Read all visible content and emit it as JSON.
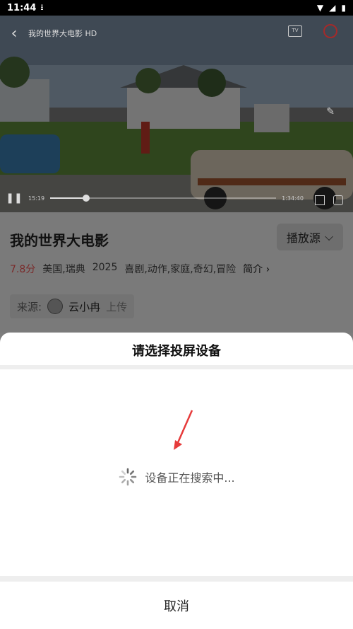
{
  "status_bar": {
    "time": "11:44"
  },
  "player": {
    "title": "我的世界大电影 HD",
    "elapsed": "15:19",
    "total": "1:34:40",
    "progress": 0.16
  },
  "movie": {
    "title": "我的世界大电影",
    "source_button": "播放源",
    "rating": "7.8分",
    "region": "美国,瑞典",
    "year": "2025",
    "genres": "喜剧,动作,家庭,奇幻,冒险",
    "intro_link": "简介"
  },
  "uploader": {
    "label": "来源:",
    "name": "云小冉",
    "suffix": "上传"
  },
  "cast_sheet": {
    "title": "请选择投屏设备",
    "searching_text": "设备正在搜索中...",
    "cancel_label": "取消"
  },
  "colors": {
    "accent_red": "#e63b3b",
    "rating_color": "#7a2a2a"
  }
}
